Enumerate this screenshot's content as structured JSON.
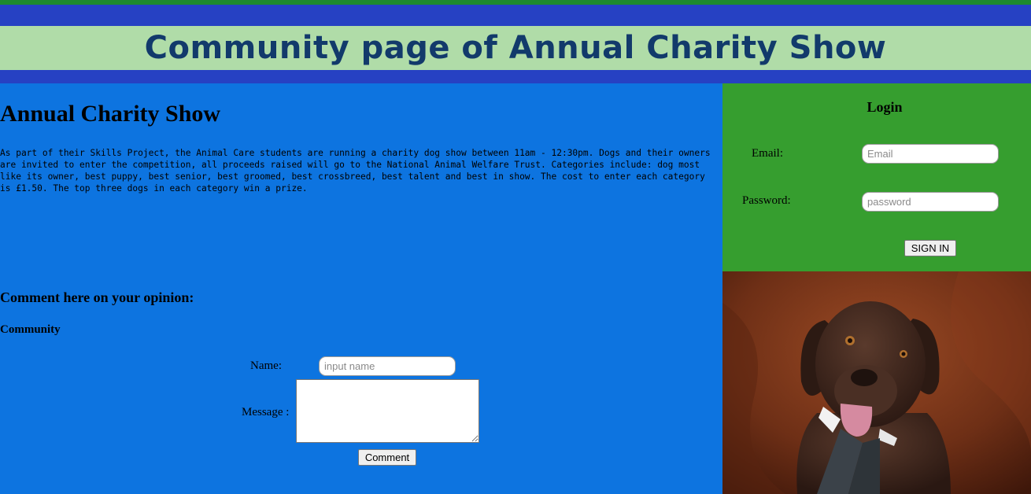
{
  "header": {
    "title": "Community page of Annual Charity Show"
  },
  "main": {
    "heading": "Annual Charity Show",
    "description": "As part of their Skills Project, the Animal Care students are running a charity dog show between 11am - 12:30pm. Dogs and their owners are invited to enter the competition, all proceeds raised will go to the National Animal Welfare Trust. Categories include: dog most like its owner, best puppy, best senior, best groomed, best crossbreed, best talent and best in show. The cost to enter each category is £1.50. The top three dogs in each category win a prize.",
    "comment_heading": "Comment here on your opinion:",
    "community_label": "Community",
    "form": {
      "name_label": "Name:",
      "name_placeholder": "input name",
      "name_value": "",
      "message_label": "Message :",
      "message_value": "",
      "submit_label": "Comment"
    }
  },
  "login": {
    "title": "Login",
    "email_label": "Email:",
    "email_placeholder": "Email",
    "email_value": "",
    "password_label": "Password:",
    "password_placeholder": "password",
    "password_value": "",
    "signin_label": "SIGN IN"
  },
  "photo": {
    "subject": "chocolate labrador dog wearing a shirt collar and tie"
  },
  "colors": {
    "top_strip": "#1d8a2d",
    "band_blue": "#2641c3",
    "title_band": "#b0dca8",
    "title_text": "#123a6b",
    "main_bg": "#0d74e0",
    "login_bg": "#369e2f"
  }
}
